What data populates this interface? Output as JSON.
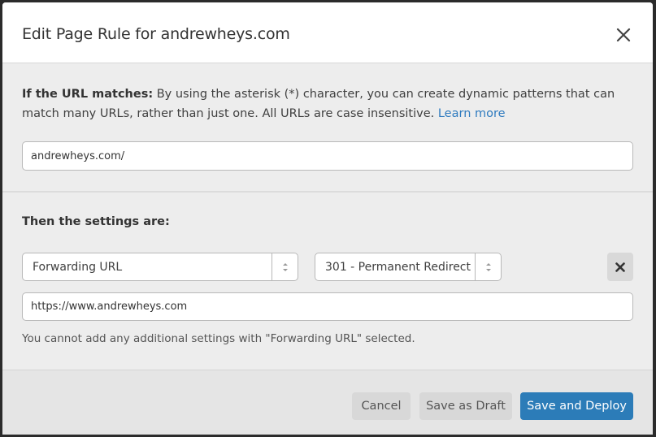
{
  "modal": {
    "title": "Edit Page Rule for andrewheys.com",
    "close_icon": "close-icon"
  },
  "url_section": {
    "label_bold": "If the URL matches:",
    "description": " By using the asterisk (*) character, you can create dynamic patterns that can match many URLs, rather than just one. All URLs are case insensitive. ",
    "learn_more": "Learn more",
    "url_value": "andrewheys.com/"
  },
  "settings_section": {
    "heading": "Then the settings are:",
    "setting_select": "Forwarding URL",
    "status_select": "301 - Permanent Redirect",
    "destination_value": "https://www.andrewheys.com",
    "remove_icon": "close-icon",
    "note": "You cannot add any additional settings with \"Forwarding URL\" selected."
  },
  "footer": {
    "cancel": "Cancel",
    "save_draft": "Save as Draft",
    "save_deploy": "Save and Deploy"
  },
  "colors": {
    "primary": "#2c7cb8",
    "link": "#2f7bbf"
  }
}
